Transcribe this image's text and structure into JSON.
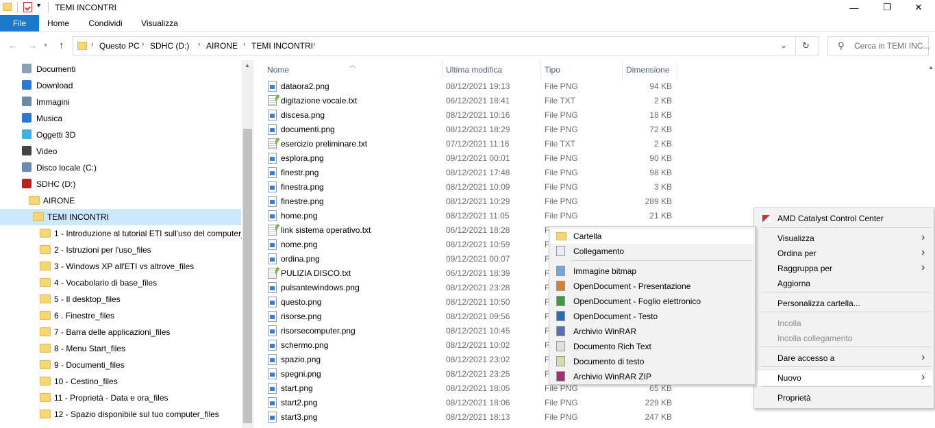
{
  "window": {
    "title": "TEMI INCONTRI",
    "minimize_glyph": "—",
    "restore_glyph": "❐",
    "close_glyph": "✕"
  },
  "ribbon": {
    "tabs": [
      "File",
      "Home",
      "Condividi",
      "Visualizza"
    ]
  },
  "address": {
    "crumbs": [
      "Questo PC",
      "SDHC (D:)",
      "AIRONE",
      "TEMI INCONTRI"
    ],
    "search_placeholder": "Cerca in TEMI INC..."
  },
  "nav": {
    "items": [
      {
        "label": "Documenti",
        "icon": "documents-icon"
      },
      {
        "label": "Download",
        "icon": "download-icon"
      },
      {
        "label": "Immagini",
        "icon": "pictures-icon"
      },
      {
        "label": "Musica",
        "icon": "music-icon"
      },
      {
        "label": "Oggetti 3D",
        "icon": "3d-objects-icon"
      },
      {
        "label": "Video",
        "icon": "video-icon"
      },
      {
        "label": "Disco locale (C:)",
        "icon": "drive-icon"
      },
      {
        "label": "SDHC (D:)",
        "icon": "sd-card-icon"
      },
      {
        "label": "AIRONE",
        "icon": "folder-icon"
      },
      {
        "label": "TEMI INCONTRI",
        "icon": "folder-icon"
      },
      {
        "label": "1 - Introduzione al tutorial ETI sull'uso del computer_",
        "icon": "folder-icon"
      },
      {
        "label": "2 - Istruzioni per l'uso_files",
        "icon": "folder-icon"
      },
      {
        "label": "3 - Windows XP all'ETI vs altrove_files",
        "icon": "folder-icon"
      },
      {
        "label": "4 - Vocabolario di base_files",
        "icon": "folder-icon"
      },
      {
        "label": "5 - Il desktop_files",
        "icon": "folder-icon"
      },
      {
        "label": "6 . Finestre_files",
        "icon": "folder-icon"
      },
      {
        "label": "7 - Barra delle applicazioni_files",
        "icon": "folder-icon"
      },
      {
        "label": "8 - Menu Start_files",
        "icon": "folder-icon"
      },
      {
        "label": "9 - Documenti_files",
        "icon": "folder-icon"
      },
      {
        "label": "10 - Cestino_files",
        "icon": "folder-icon"
      },
      {
        "label": "11 - Proprietà - Data e ora_files",
        "icon": "folder-icon"
      },
      {
        "label": "12 - Spazio disponibile sul tuo computer_files",
        "icon": "folder-icon"
      }
    ]
  },
  "files": {
    "columns": [
      "Nome",
      "Ultima modifica",
      "Tipo",
      "Dimensione"
    ],
    "rows": [
      {
        "name": "dataora2.png",
        "date": "08/12/2021 19:13",
        "type": "File PNG",
        "size": "94 KB",
        "kind": "png"
      },
      {
        "name": "digitazione vocale.txt",
        "date": "06/12/2021 18:41",
        "type": "File TXT",
        "size": "2 KB",
        "kind": "txt"
      },
      {
        "name": "discesa.png",
        "date": "08/12/2021 10:16",
        "type": "File PNG",
        "size": "18 KB",
        "kind": "png"
      },
      {
        "name": "documenti.png",
        "date": "08/12/2021 18:29",
        "type": "File PNG",
        "size": "72 KB",
        "kind": "png"
      },
      {
        "name": "esercizio preliminare.txt",
        "date": "07/12/2021 11:16",
        "type": "File TXT",
        "size": "2 KB",
        "kind": "txt"
      },
      {
        "name": "esplora.png",
        "date": "09/12/2021 00:01",
        "type": "File PNG",
        "size": "90 KB",
        "kind": "png"
      },
      {
        "name": "finestr.png",
        "date": "08/12/2021 17:48",
        "type": "File PNG",
        "size": "98 KB",
        "kind": "png"
      },
      {
        "name": "finestra.png",
        "date": "08/12/2021 10:09",
        "type": "File PNG",
        "size": "3 KB",
        "kind": "png"
      },
      {
        "name": "finestre.png",
        "date": "08/12/2021 10:29",
        "type": "File PNG",
        "size": "289 KB",
        "kind": "png"
      },
      {
        "name": "home.png",
        "date": "08/12/2021 11:05",
        "type": "File PNG",
        "size": "21 KB",
        "kind": "png"
      },
      {
        "name": "link sistema operativo.txt",
        "date": "06/12/2021 18:28",
        "type": "F",
        "size": "",
        "kind": "txt"
      },
      {
        "name": "nome.png",
        "date": "08/12/2021 10:59",
        "type": "F",
        "size": "",
        "kind": "png"
      },
      {
        "name": "ordina.png",
        "date": "09/12/2021 00:07",
        "type": "F",
        "size": "",
        "kind": "png"
      },
      {
        "name": "PULIZIA DISCO.txt",
        "date": "06/12/2021 18:39",
        "type": "F",
        "size": "",
        "kind": "txt"
      },
      {
        "name": "pulsantewindows.png",
        "date": "08/12/2021 23:28",
        "type": "F",
        "size": "",
        "kind": "png"
      },
      {
        "name": "questo.png",
        "date": "08/12/2021 10:50",
        "type": "F",
        "size": "",
        "kind": "png"
      },
      {
        "name": "risorse.png",
        "date": "08/12/2021 09:56",
        "type": "F",
        "size": "",
        "kind": "png"
      },
      {
        "name": "risorsecomputer.png",
        "date": "08/12/2021 10:45",
        "type": "F",
        "size": "",
        "kind": "png"
      },
      {
        "name": "schermo.png",
        "date": "08/12/2021 10:02",
        "type": "F",
        "size": "",
        "kind": "png"
      },
      {
        "name": "spazio.png",
        "date": "08/12/2021 23:02",
        "type": "F",
        "size": "",
        "kind": "png"
      },
      {
        "name": "spegni.png",
        "date": "08/12/2021 23:25",
        "type": "F",
        "size": "",
        "kind": "png"
      },
      {
        "name": "start.png",
        "date": "08/12/2021 18:05",
        "type": "File PNG",
        "size": "65 KB",
        "kind": "png"
      },
      {
        "name": "start2.png",
        "date": "08/12/2021 18:06",
        "type": "File PNG",
        "size": "229 KB",
        "kind": "png"
      },
      {
        "name": "start3.png",
        "date": "08/12/2021 18:13",
        "type": "File PNG",
        "size": "247 KB",
        "kind": "png"
      }
    ]
  },
  "context_menu": {
    "items": [
      {
        "label": "AMD Catalyst Control Center",
        "icon": "amd-icon",
        "disabled": false,
        "submenu": false
      },
      {
        "label": "Visualizza",
        "disabled": false,
        "submenu": true
      },
      {
        "label": "Ordina per",
        "disabled": false,
        "submenu": true
      },
      {
        "label": "Raggruppa per",
        "disabled": false,
        "submenu": true
      },
      {
        "label": "Aggiorna",
        "disabled": false,
        "submenu": false
      },
      {
        "label": "Personalizza cartella...",
        "disabled": false,
        "submenu": false
      },
      {
        "label": "Incolla",
        "disabled": true,
        "submenu": false
      },
      {
        "label": "Incolla collegamento",
        "disabled": true,
        "submenu": false
      },
      {
        "label": "Dare accesso a",
        "disabled": false,
        "submenu": true
      },
      {
        "label": "Nuovo",
        "disabled": false,
        "submenu": true,
        "highlighted": true
      },
      {
        "label": "Proprietà",
        "disabled": false,
        "submenu": false
      }
    ]
  },
  "submenu_new": {
    "items": [
      {
        "label": "Cartella",
        "icon": "folder-icon"
      },
      {
        "label": "Collegamento",
        "icon": "shortcut-icon"
      },
      {
        "label": "Immagine bitmap",
        "icon": "bitmap-icon"
      },
      {
        "label": "OpenDocument - Presentazione",
        "icon": "odp-icon"
      },
      {
        "label": "OpenDocument - Foglio elettronico",
        "icon": "ods-icon"
      },
      {
        "label": "OpenDocument - Testo",
        "icon": "odt-icon"
      },
      {
        "label": "Archivio WinRAR",
        "icon": "winrar-icon"
      },
      {
        "label": "Documento Rich Text",
        "icon": "rtf-icon"
      },
      {
        "label": "Documento di testo",
        "icon": "text-document-icon"
      },
      {
        "label": "Archivio WinRAR ZIP",
        "icon": "winrar-zip-icon"
      }
    ]
  },
  "colors": {
    "accent": "#1979ca",
    "selection": "#cce8ff",
    "folder": "#f7d774"
  }
}
